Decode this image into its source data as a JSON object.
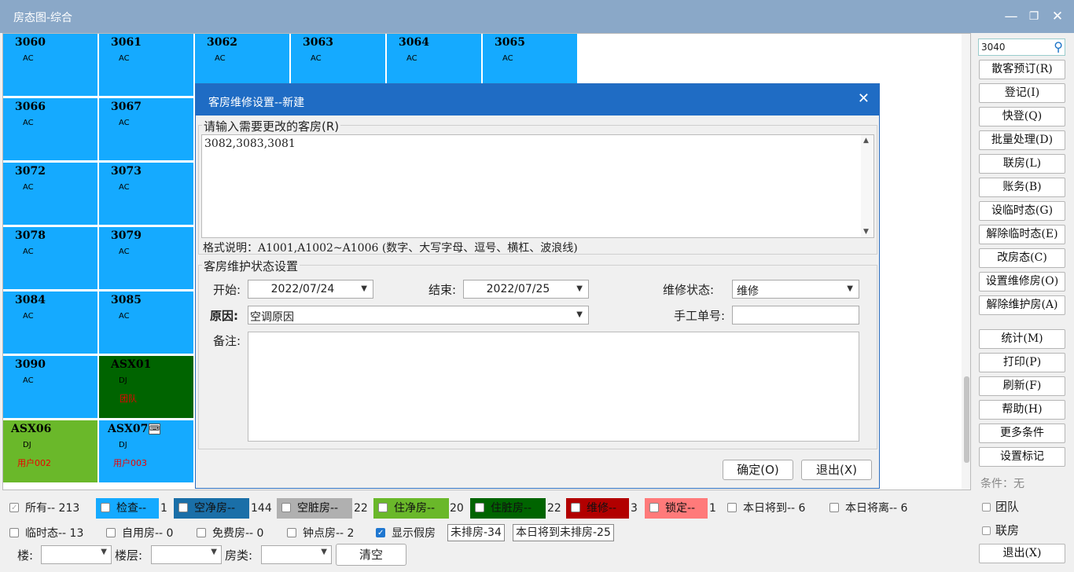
{
  "window": {
    "title": "房态图-综合"
  },
  "rooms": [
    {
      "no": "3060",
      "type": "AC",
      "guest": ""
    },
    {
      "no": "3061",
      "type": "AC",
      "guest": ""
    },
    {
      "no": "3062",
      "type": "AC",
      "guest": ""
    },
    {
      "no": "3063",
      "type": "AC",
      "guest": ""
    },
    {
      "no": "3064",
      "type": "AC",
      "guest": ""
    },
    {
      "no": "3065",
      "type": "AC",
      "guest": ""
    },
    {
      "no": "3066",
      "type": "AC",
      "guest": ""
    },
    {
      "no": "3067",
      "type": "AC",
      "guest": ""
    },
    {
      "no": "3072",
      "type": "AC",
      "guest": ""
    },
    {
      "no": "3073",
      "type": "AC",
      "guest": ""
    },
    {
      "no": "3078",
      "type": "AC",
      "guest": ""
    },
    {
      "no": "3079",
      "type": "AC",
      "guest": ""
    },
    {
      "no": "3084",
      "type": "AC",
      "guest": ""
    },
    {
      "no": "3085",
      "type": "AC",
      "guest": ""
    },
    {
      "no": "3090",
      "type": "AC",
      "guest": ""
    },
    {
      "no": "ASX01",
      "type": "DJ",
      "guest": "团队"
    },
    {
      "no": "ASX06",
      "type": "DJ",
      "guest": "用户002"
    },
    {
      "no": "ASX07",
      "type": "DJ",
      "guest": "用户003"
    }
  ],
  "search": {
    "value": "3040"
  },
  "right_buttons": [
    "散客预订(R)",
    "登记(I)",
    "快登(Q)",
    "批量处理(D)",
    "联房(L)",
    "账务(B)",
    "设临时态(G)",
    "解除临时态(E)",
    "改房态(C)",
    "设置维修房(O)",
    "解除维护房(A)",
    "统计(M)",
    "打印(P)",
    "刷新(F)",
    "帮助(H)",
    "更多条件",
    "设置标记"
  ],
  "condition": "条件：无",
  "right_checks": [
    "团队",
    "联房"
  ],
  "exit_button": "退出(X)",
  "legend": {
    "all": "所有-- 213",
    "check": "检查--",
    "check_n": "1",
    "vacant_clean": "空净房--",
    "vacant_clean_n": "144",
    "vacant_dirty": "空脏房--",
    "vacant_dirty_n": "22",
    "occ_clean": "住净房--",
    "occ_clean_n": "20",
    "occ_dirty": "住脏房--",
    "occ_dirty_n": "22",
    "repair": "维修--",
    "repair_n": "3",
    "locked": "锁定--",
    "locked_n": "1",
    "arrive_today": "本日将到-- 6",
    "depart_today": "本日将离-- 6",
    "temp": "临时态-- 13",
    "self_use": "自用房-- 0",
    "free": "免费房-- 0",
    "hourly": "钟点房-- 2",
    "show_fake": "显示假房",
    "unassigned": "未排房-34",
    "arrive_unassigned": "本日将到未排房-25"
  },
  "filters": {
    "building": "楼:",
    "floor": "楼层:",
    "room_type": "房类:",
    "clear": "清空"
  },
  "colors": {
    "vacant": "#15aaff",
    "occ_dirty": "#006400",
    "occ_clean": "#6ab82a",
    "repair": "#b20000",
    "locked": "#ff7a7a"
  },
  "dialog": {
    "title": "客房维修设置--新建",
    "rooms_label": "请输入需要更改的客房(R)",
    "rooms_value": "3082,3083,3081",
    "hint": "格式说明：A1001,A1002~A1006 (数字、大写字母、逗号、横杠、波浪线)",
    "group_label": "客房维护状态设置",
    "start_label": "开始:",
    "start_value": "2022/07/24",
    "end_label": "结束:",
    "end_value": "2022/07/25",
    "status_label": "维修状态:",
    "status_value": "维修",
    "reason_label": "原因:",
    "reason_value": "空调原因",
    "manual_label": "手工单号:",
    "manual_value": "",
    "note_label": "备注:",
    "ok": "确定(O)",
    "cancel": "退出(X)"
  }
}
